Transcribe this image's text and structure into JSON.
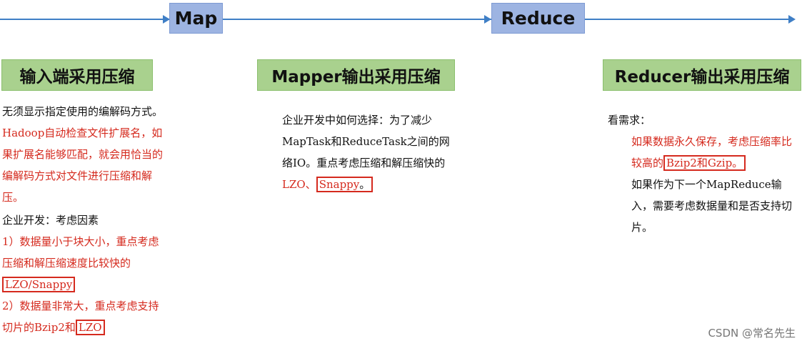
{
  "flow": {
    "map_label": "Map",
    "reduce_label": "Reduce"
  },
  "columns": {
    "input": {
      "heading": "输入端采用压缩",
      "para1_a": "无须显示指定使用的编解码方式。",
      "para1_b": "Hadoop自动检查文件扩展名，如果扩展名能够匹配，就会用恰当的编解码方式对文件进行压缩和解压。",
      "para2_title": "企业开发：考虑因素",
      "item1_a": "1）数据量小于块大小，重点考虑压缩和解压缩速度比较快的",
      "item1_boxed": "LZO/Snappy",
      "item2_a": "2）数据量非常大，重点考虑支持切片的Bzip2和",
      "item2_boxed": "LZO"
    },
    "mapper": {
      "heading": "Mapper输出采用压缩",
      "para_a": "企业开发中如何选择：为了减少MapTask和ReduceTask之间的网络IO。重点考虑压缩和解压缩快的",
      "para_red": "LZO、",
      "para_boxed": "Snappy",
      "para_end": "。"
    },
    "reducer": {
      "heading": "Reducer输出采用压缩",
      "intro": "看需求：",
      "line1_a": "如果数据永久保存，考虑压缩率比较高的",
      "line1_boxed": "Bzip2和Gzip",
      "line1_end": "。",
      "line2": "如果作为下一个MapReduce输入，需要考虑数据量和是否支持切片。"
    }
  },
  "watermark": "CSDN @常名先生",
  "colors": {
    "flow_line": "#3f7fc6",
    "stage_box": "#9db4e2",
    "heading_box": "#a9d18e",
    "highlight": "#d52a1e"
  }
}
